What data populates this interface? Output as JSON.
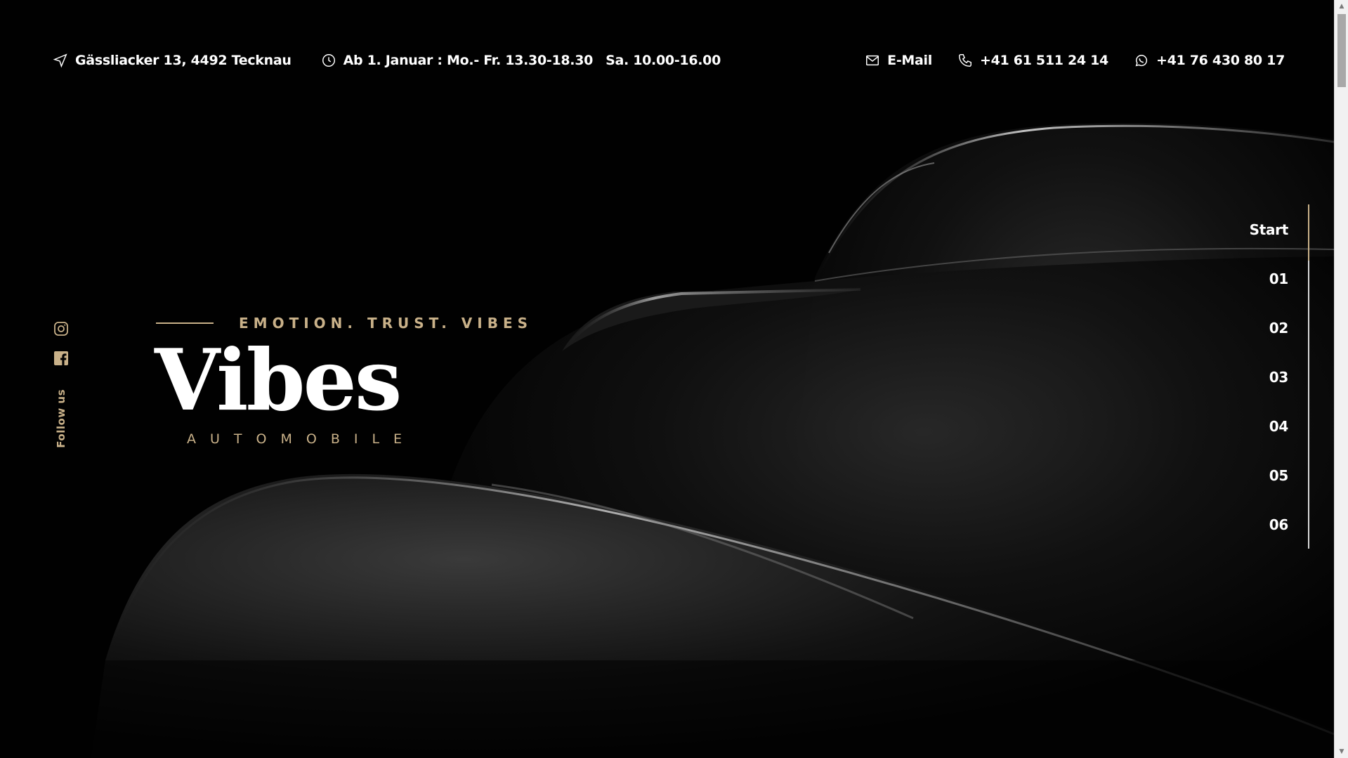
{
  "topbar": {
    "address": "Gässliacker 13, 4492 Tecknau",
    "hours_week": "Ab 1. Januar : Mo.- Fr. 13.30-18.30",
    "hours_sat": "Sa. 10.00-16.00",
    "email_label": "E-Mail",
    "phone": "+41 61 511 24 14",
    "whatsapp": "+41 76 430 80 17"
  },
  "social": {
    "icons": [
      "instagram-icon",
      "facebook-icon"
    ],
    "follow_label": "Follow us"
  },
  "hero": {
    "tagline": "EMOTION. TRUST. VIBES",
    "brand": "Vibes",
    "brand_sub": "AUTOMOBILE"
  },
  "slide_nav": {
    "items": [
      "Start",
      "01",
      "02",
      "03",
      "04",
      "05",
      "06"
    ],
    "active_index": 0
  },
  "colors": {
    "background": "#010101",
    "accent_gold": "#c9b189",
    "text": "#ffffff"
  }
}
